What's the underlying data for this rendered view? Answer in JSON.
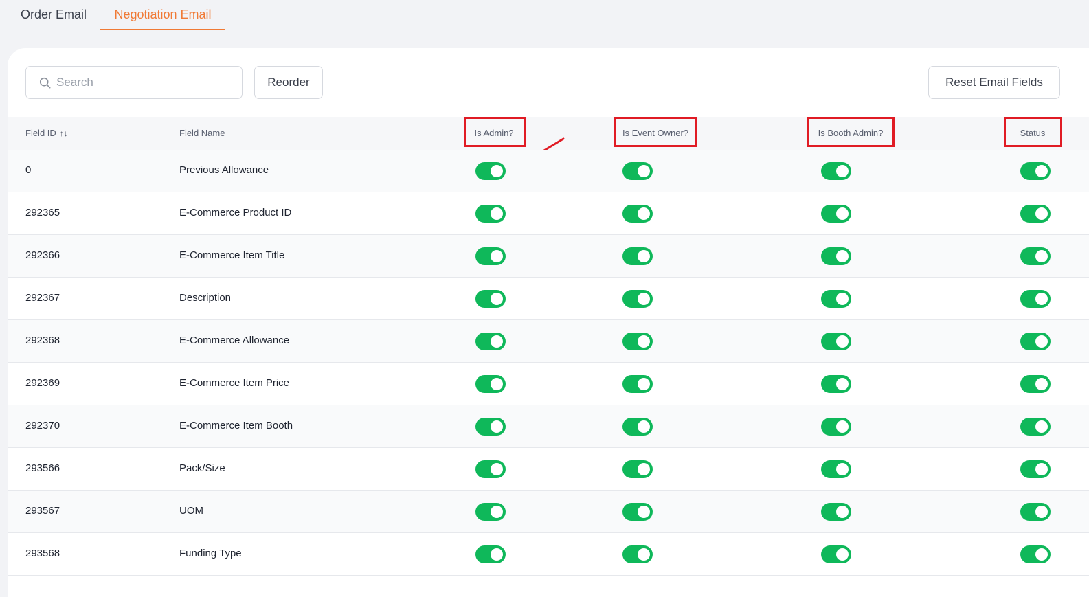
{
  "tabs": [
    {
      "label": "Order Email",
      "active": false
    },
    {
      "label": "Negotiation Email",
      "active": true
    }
  ],
  "toolbar": {
    "search_placeholder": "Search",
    "search_value": "",
    "reorder_label": "Reorder",
    "reset_label": "Reset Email Fields"
  },
  "columns": {
    "field_id": "Field ID",
    "field_name": "Field Name",
    "is_admin": "Is Admin?",
    "is_event_owner": "Is Event Owner?",
    "is_booth_admin": "Is Booth Admin?",
    "status": "Status"
  },
  "icons": {
    "search": "search-icon",
    "sort": "sort-icon"
  },
  "colors": {
    "accent": "#f07a35",
    "toggle_on": "#0fb85a",
    "highlight": "#e01b24"
  },
  "rows": [
    {
      "id": "0",
      "name": "Previous Allowance",
      "is_admin": true,
      "is_event_owner": true,
      "is_booth_admin": true,
      "status": true
    },
    {
      "id": "292365",
      "name": "E-Commerce Product ID",
      "is_admin": true,
      "is_event_owner": true,
      "is_booth_admin": true,
      "status": true
    },
    {
      "id": "292366",
      "name": "E-Commerce Item Title",
      "is_admin": true,
      "is_event_owner": true,
      "is_booth_admin": true,
      "status": true
    },
    {
      "id": "292367",
      "name": "Description",
      "is_admin": true,
      "is_event_owner": true,
      "is_booth_admin": true,
      "status": true
    },
    {
      "id": "292368",
      "name": "E-Commerce Allowance",
      "is_admin": true,
      "is_event_owner": true,
      "is_booth_admin": true,
      "status": true
    },
    {
      "id": "292369",
      "name": "E-Commerce Item Price",
      "is_admin": true,
      "is_event_owner": true,
      "is_booth_admin": true,
      "status": true
    },
    {
      "id": "292370",
      "name": "E-Commerce Item Booth",
      "is_admin": true,
      "is_event_owner": true,
      "is_booth_admin": true,
      "status": true
    },
    {
      "id": "293566",
      "name": "Pack/Size",
      "is_admin": true,
      "is_event_owner": true,
      "is_booth_admin": true,
      "status": true
    },
    {
      "id": "293567",
      "name": "UOM",
      "is_admin": true,
      "is_event_owner": true,
      "is_booth_admin": true,
      "status": true
    },
    {
      "id": "293568",
      "name": "Funding Type",
      "is_admin": true,
      "is_event_owner": true,
      "is_booth_admin": true,
      "status": true
    }
  ]
}
